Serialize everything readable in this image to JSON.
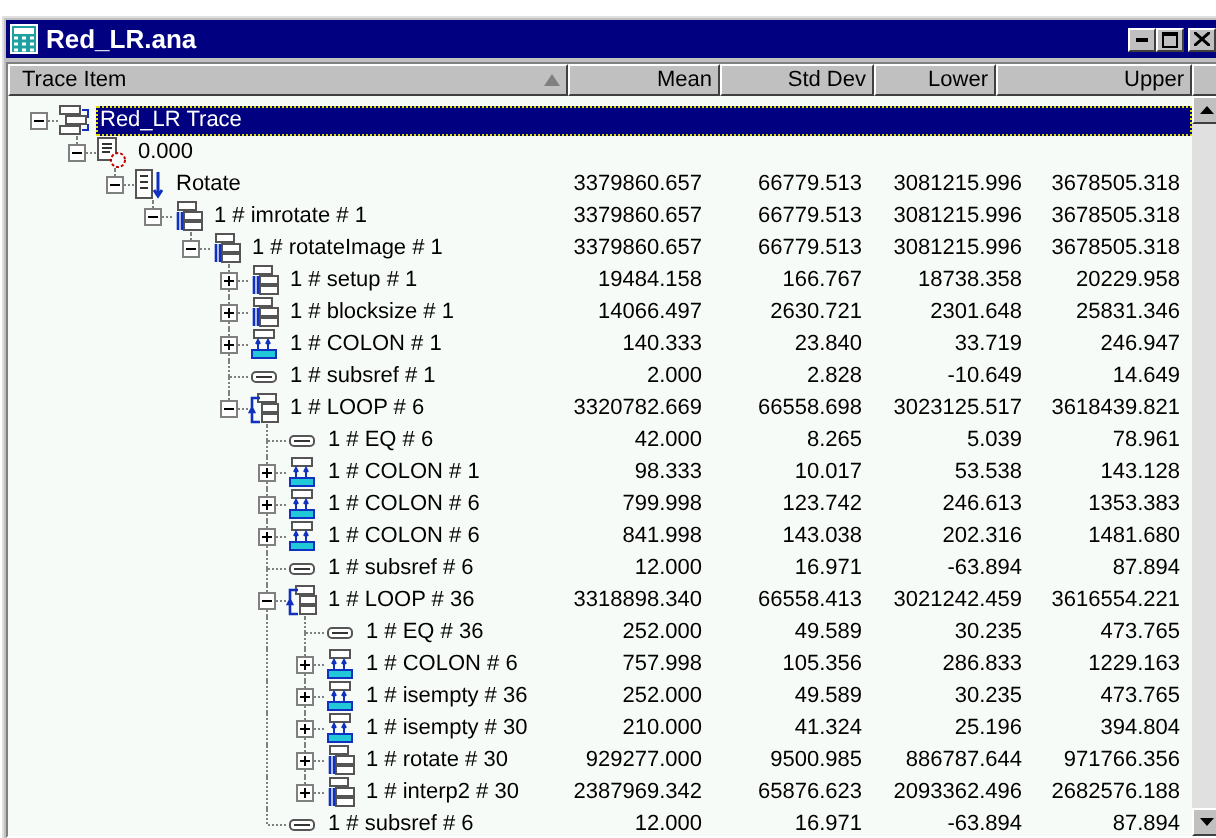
{
  "window": {
    "title": "Red_LR.ana"
  },
  "columns": [
    {
      "label": "Trace Item",
      "sorted": true
    },
    {
      "label": "Mean",
      "sorted": false
    },
    {
      "label": "Std Dev",
      "sorted": false
    },
    {
      "label": "Lower",
      "sorted": false
    },
    {
      "label": "Upper",
      "sorted": false
    }
  ],
  "tree": [
    {
      "label": "Red_LR Trace",
      "kind": "trace",
      "selected": true,
      "expanded": true,
      "children": [
        {
          "label": "0.000",
          "kind": "time",
          "selected": false,
          "expanded": true,
          "children": [
            {
              "label": "Rotate",
              "kind": "function",
              "selected": false,
              "expanded": true,
              "mean": "3379860.657",
              "std_dev": "66779.513",
              "lower": "3081215.996",
              "upper": "3678505.318",
              "children": [
                {
                  "label": "1 # imrotate  # 1",
                  "kind": "call",
                  "selected": false,
                  "expanded": true,
                  "mean": "3379860.657",
                  "std_dev": "66779.513",
                  "lower": "3081215.996",
                  "upper": "3678505.318",
                  "children": [
                    {
                      "label": "1 # rotateImage  # 1",
                      "kind": "call",
                      "selected": false,
                      "expanded": true,
                      "mean": "3379860.657",
                      "std_dev": "66779.513",
                      "lower": "3081215.996",
                      "upper": "3678505.318",
                      "children": [
                        {
                          "label": "1 # setup  # 1",
                          "kind": "call",
                          "selected": false,
                          "expanded": false,
                          "mean": "19484.158",
                          "std_dev": "166.767",
                          "lower": "18738.358",
                          "upper": "20229.958"
                        },
                        {
                          "label": "1 # blocksize  # 1",
                          "kind": "call",
                          "selected": false,
                          "expanded": false,
                          "mean": "14066.497",
                          "std_dev": "2630.721",
                          "lower": "2301.648",
                          "upper": "25831.346"
                        },
                        {
                          "label": "1 # COLON  # 1",
                          "kind": "colon",
                          "selected": false,
                          "expanded": false,
                          "mean": "140.333",
                          "std_dev": "23.840",
                          "lower": "33.719",
                          "upper": "246.947"
                        },
                        {
                          "label": "1 # subsref  # 1",
                          "kind": "leaf",
                          "selected": false,
                          "mean": "2.000",
                          "std_dev": "2.828",
                          "lower": "-10.649",
                          "upper": "14.649"
                        },
                        {
                          "label": "1 # LOOP  # 6",
                          "kind": "loop",
                          "selected": false,
                          "expanded": true,
                          "mean": "3320782.669",
                          "std_dev": "66558.698",
                          "lower": "3023125.517",
                          "upper": "3618439.821",
                          "children": [
                            {
                              "label": "1 # EQ  # 6",
                              "kind": "leaf",
                              "selected": false,
                              "mean": "42.000",
                              "std_dev": "8.265",
                              "lower": "5.039",
                              "upper": "78.961"
                            },
                            {
                              "label": "1 # COLON  # 1",
                              "kind": "colon",
                              "selected": false,
                              "expanded": false,
                              "mean": "98.333",
                              "std_dev": "10.017",
                              "lower": "53.538",
                              "upper": "143.128"
                            },
                            {
                              "label": "1 # COLON  # 6",
                              "kind": "colon",
                              "selected": false,
                              "expanded": false,
                              "mean": "799.998",
                              "std_dev": "123.742",
                              "lower": "246.613",
                              "upper": "1353.383"
                            },
                            {
                              "label": "1 # COLON  # 6",
                              "kind": "colon",
                              "selected": false,
                              "expanded": false,
                              "mean": "841.998",
                              "std_dev": "143.038",
                              "lower": "202.316",
                              "upper": "1481.680"
                            },
                            {
                              "label": "1 # subsref  # 6",
                              "kind": "leaf",
                              "selected": false,
                              "mean": "12.000",
                              "std_dev": "16.971",
                              "lower": "-63.894",
                              "upper": "87.894"
                            },
                            {
                              "label": "1 # LOOP  # 36",
                              "kind": "loop",
                              "selected": false,
                              "expanded": true,
                              "mean": "3318898.340",
                              "std_dev": "66558.413",
                              "lower": "3021242.459",
                              "upper": "3616554.221",
                              "children": [
                                {
                                  "label": "1 # EQ  # 36",
                                  "kind": "leaf",
                                  "selected": false,
                                  "mean": "252.000",
                                  "std_dev": "49.589",
                                  "lower": "30.235",
                                  "upper": "473.765"
                                },
                                {
                                  "label": "1 # COLON  # 6",
                                  "kind": "colon",
                                  "selected": false,
                                  "expanded": false,
                                  "mean": "757.998",
                                  "std_dev": "105.356",
                                  "lower": "286.833",
                                  "upper": "1229.163"
                                },
                                {
                                  "label": "1 # isempty  # 36",
                                  "kind": "colon",
                                  "selected": false,
                                  "expanded": false,
                                  "mean": "252.000",
                                  "std_dev": "49.589",
                                  "lower": "30.235",
                                  "upper": "473.765"
                                },
                                {
                                  "label": "1 # isempty  # 30",
                                  "kind": "colon",
                                  "selected": false,
                                  "expanded": false,
                                  "mean": "210.000",
                                  "std_dev": "41.324",
                                  "lower": "25.196",
                                  "upper": "394.804"
                                },
                                {
                                  "label": "1 # rotate  # 30",
                                  "kind": "call",
                                  "selected": false,
                                  "expanded": false,
                                  "mean": "929277.000",
                                  "std_dev": "9500.985",
                                  "lower": "886787.644",
                                  "upper": "971766.356"
                                },
                                {
                                  "label": "1 # interp2  # 30",
                                  "kind": "call",
                                  "selected": false,
                                  "expanded": false,
                                  "mean": "2387969.342",
                                  "std_dev": "65876.623",
                                  "lower": "2093362.496",
                                  "upper": "2682576.188"
                                }
                              ]
                            },
                            {
                              "label": "1 # subsref  # 6",
                              "kind": "leaf",
                              "selected": false,
                              "mean": "12.000",
                              "std_dev": "16.971",
                              "lower": "-63.894",
                              "upper": "87.894"
                            }
                          ]
                        }
                      ]
                    }
                  ]
                }
              ]
            }
          ]
        }
      ]
    }
  ]
}
